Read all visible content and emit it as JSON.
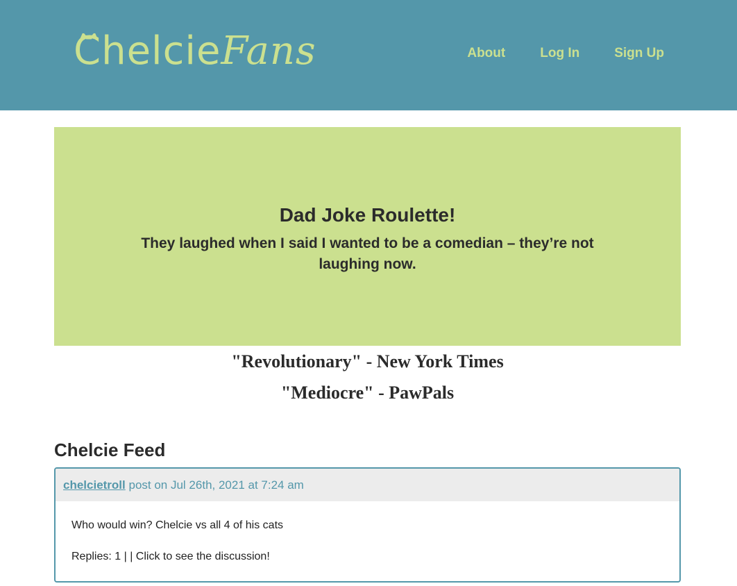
{
  "header": {
    "logo_part1": "Chelcie",
    "logo_part2": "Fans",
    "nav": [
      "About",
      "Log In",
      "Sign Up"
    ]
  },
  "banner": {
    "title": "Dad Joke Roulette!",
    "joke": "They laughed when I said I wanted to be a comedian – they’re not laughing now."
  },
  "quotes": [
    "\"Revolutionary\" - New York Times",
    "\"Mediocre\" - PawPals"
  ],
  "feed": {
    "title": "Chelcie Feed",
    "posts": [
      {
        "author": "chelcietroll",
        "meta": " post on Jul 26th, 2021 at 7:24 am",
        "content": "Who would win? Chelcie vs all 4 of his cats",
        "replies": "Replies: 1 | | Click to see the discussion!"
      }
    ]
  },
  "colors": {
    "header_bg": "#5497aa",
    "accent_green": "#cbe08f",
    "text_dark": "#2b2b2b"
  },
  "icons": {
    "logo_mark": "cat-ears-icon"
  }
}
